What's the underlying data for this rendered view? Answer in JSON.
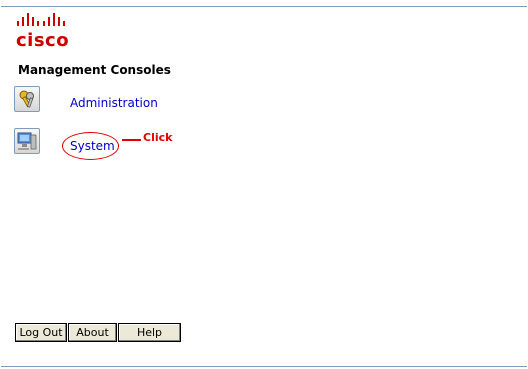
{
  "logo": {
    "text": "cisco",
    "icon": "cisco-logo-bars"
  },
  "heading": "Management Consoles",
  "consoles": [
    {
      "label": "Administration",
      "icon": "admin-keys-icon"
    },
    {
      "label": "System",
      "icon": "system-computer-icon"
    }
  ],
  "annotation": {
    "text": "Click",
    "color": "#e00000"
  },
  "buttons": {
    "logout": "Log Out",
    "about": "About",
    "help": "Help"
  },
  "colors": {
    "brand": "#cc0000",
    "link": "#0000cc",
    "border": "#7f9db9"
  }
}
